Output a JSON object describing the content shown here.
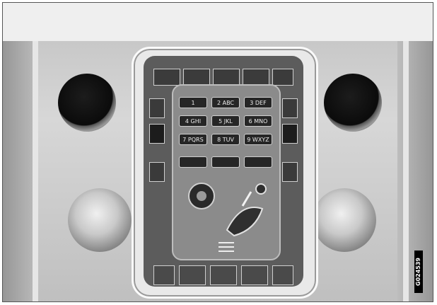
{
  "figure_id": "G024539",
  "console": {
    "top_keys": [
      "",
      "",
      "",
      "",
      ""
    ],
    "keypad_rows": [
      [
        "1",
        "2 ABC",
        "3 DEF"
      ],
      [
        "4 GHI",
        "5 JKL",
        "6 MNO"
      ],
      [
        "7 PQRS",
        "8 TUV",
        "9 WXYZ"
      ],
      [
        "",
        "",
        ""
      ]
    ],
    "side_keys_left": [
      "",
      "",
      ""
    ],
    "side_keys_right": [
      "",
      "",
      ""
    ],
    "bottom_keys": [
      "",
      "",
      "",
      "",
      ""
    ]
  },
  "colors": {
    "console_dark": "#5c5c5c",
    "key_black": "#262626",
    "dash_grey": "#c8c8c8"
  },
  "icons": {
    "seat": "seat-airflow-icon",
    "defrost": "defrost-icon",
    "fan": "fan-icon"
  }
}
